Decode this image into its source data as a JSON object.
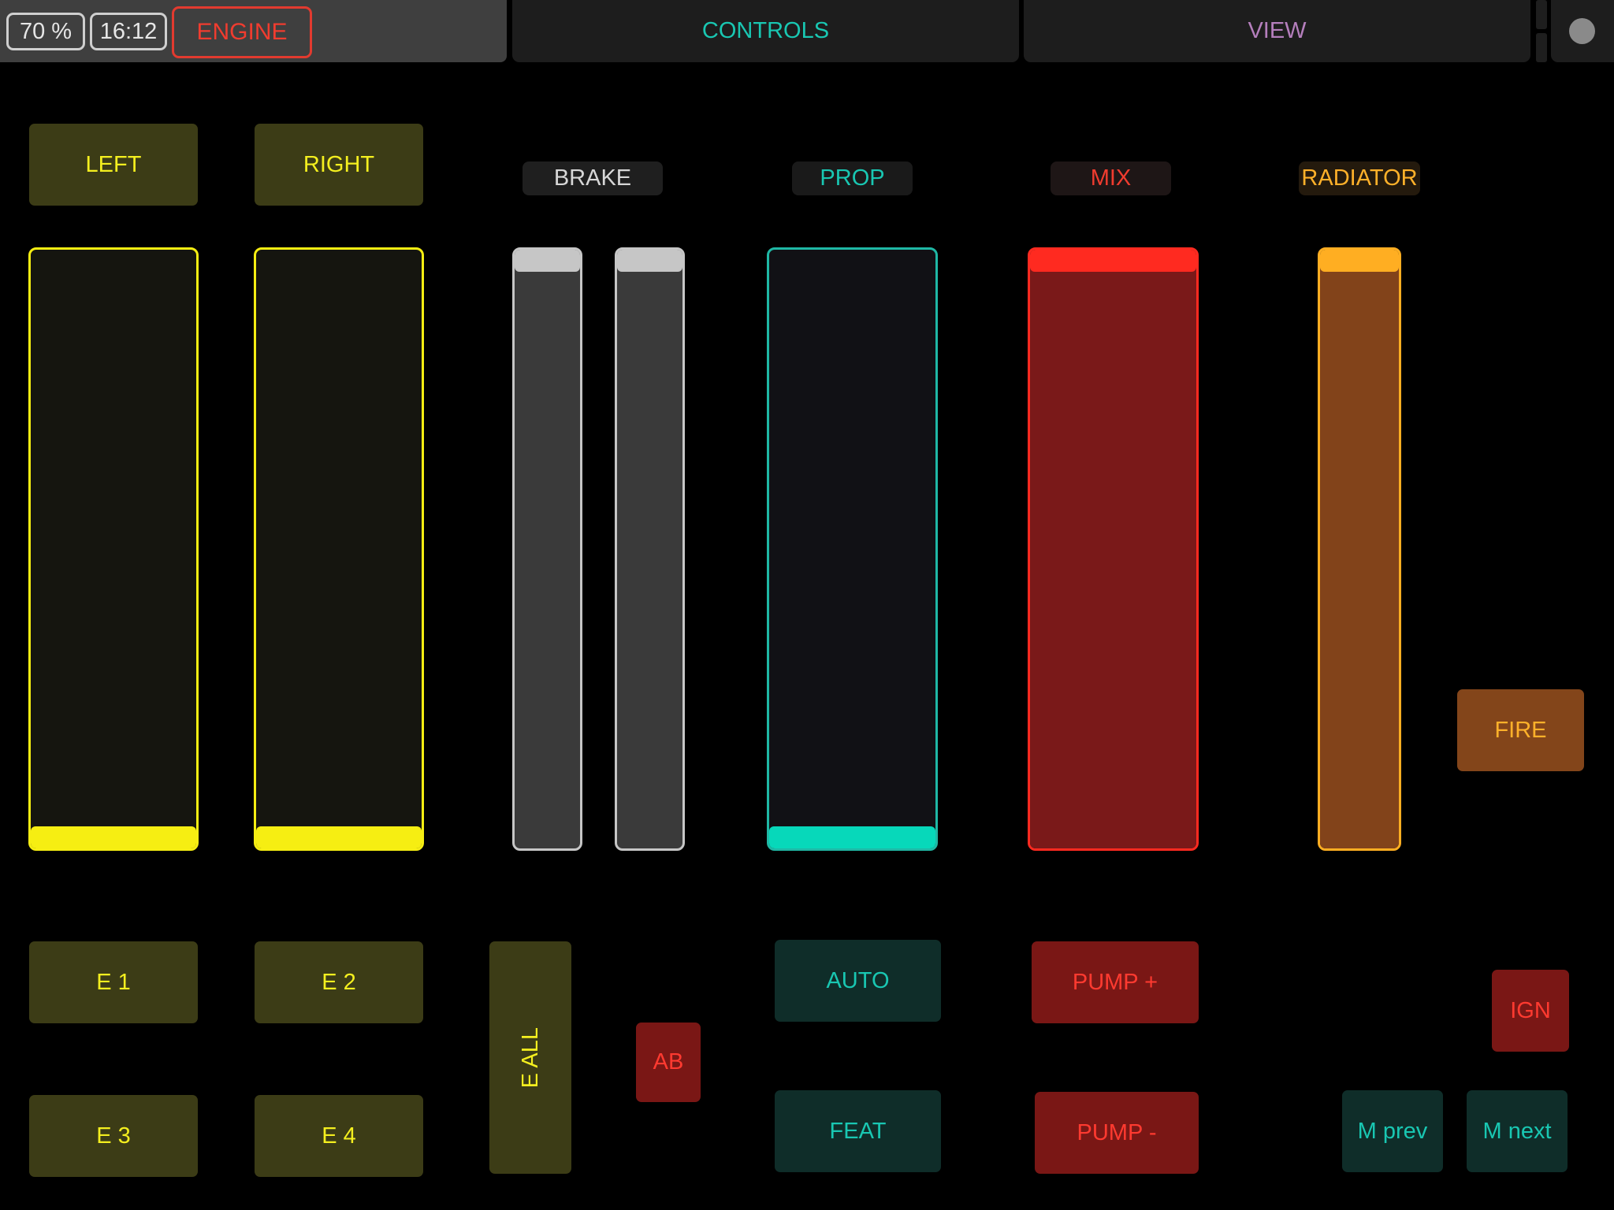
{
  "header": {
    "zoom": "70 %",
    "time": "16:12",
    "engine_label": "ENGINE",
    "tabs": [
      {
        "label": "CONTROLS",
        "color": "#19c7b2"
      },
      {
        "label": "VIEW",
        "color": "#b57fbd"
      }
    ]
  },
  "top_buttons": {
    "left": "LEFT",
    "right": "RIGHT"
  },
  "section_labels": {
    "brake": "BRAKE",
    "prop": "PROP",
    "mix": "MIX",
    "radiator": "RADIATOR"
  },
  "faders": {
    "left": {
      "value": 0.0,
      "color": "#f6ee12"
    },
    "right": {
      "value": 0.0,
      "color": "#f6ee12"
    },
    "brake_1": {
      "value": 1.0,
      "color": "#c6c6c6"
    },
    "brake_2": {
      "value": 1.0,
      "color": "#c6c6c6"
    },
    "prop": {
      "value": 0.0,
      "color": "#07d8ba"
    },
    "mix": {
      "value": 1.0,
      "color": "#ff2a20"
    },
    "radiator": {
      "value": 1.0,
      "color": "#ffae22"
    }
  },
  "buttons": {
    "fire": "FIRE",
    "e1": "E 1",
    "e2": "E 2",
    "e3": "E 3",
    "e4": "E 4",
    "e_all": "E ALL",
    "ab": "AB",
    "auto": "AUTO",
    "feat": "FEAT",
    "pump_plus": "PUMP +",
    "pump_minus": "PUMP -",
    "ign": "IGN",
    "m_prev": "M prev",
    "m_next": "M next"
  }
}
